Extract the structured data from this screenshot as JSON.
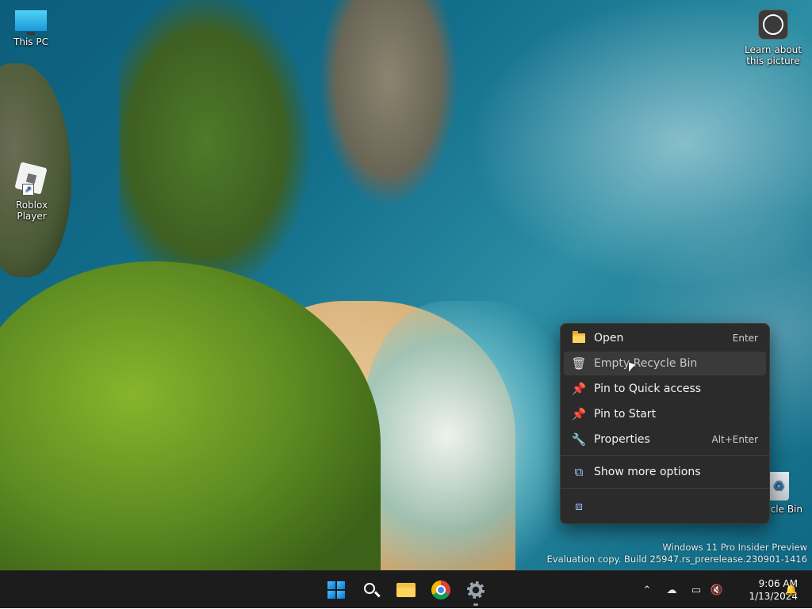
{
  "desktop": {
    "icons": {
      "this_pc": "This PC",
      "roblox": "Roblox Player",
      "learn_line1": "Learn about",
      "learn_line2": "this picture",
      "recycle_bin": "cle Bin"
    },
    "watermark": {
      "line1": "Windows 11 Pro Insider Preview",
      "line2": "Evaluation copy. Build 25947.rs_prerelease.230901-1416"
    }
  },
  "context_menu": {
    "items": [
      {
        "label": "Open",
        "shortcut": "Enter",
        "icon": "folder-icon"
      },
      {
        "label": "Empty Recycle Bin",
        "shortcut": "",
        "icon": "trash-icon"
      },
      {
        "label": "Pin to Quick access",
        "shortcut": "",
        "icon": "pin-icon"
      },
      {
        "label": "Pin to Start",
        "shortcut": "",
        "icon": "pin-icon"
      },
      {
        "label": "Properties",
        "shortcut": "Alt+Enter",
        "icon": "wrench-icon"
      },
      {
        "label": "Show more options",
        "shortcut": "",
        "icon": "share-expand-icon"
      }
    ],
    "ai_icon": "ai-text-icon"
  },
  "taskbar": {
    "apps": [
      "start-icon",
      "search-icon",
      "file-explorer-icon",
      "chrome-icon",
      "settings-icon"
    ],
    "clock": {
      "time": "9:06 AM",
      "date": "1/13/2024"
    },
    "accent": "#0078d4"
  }
}
